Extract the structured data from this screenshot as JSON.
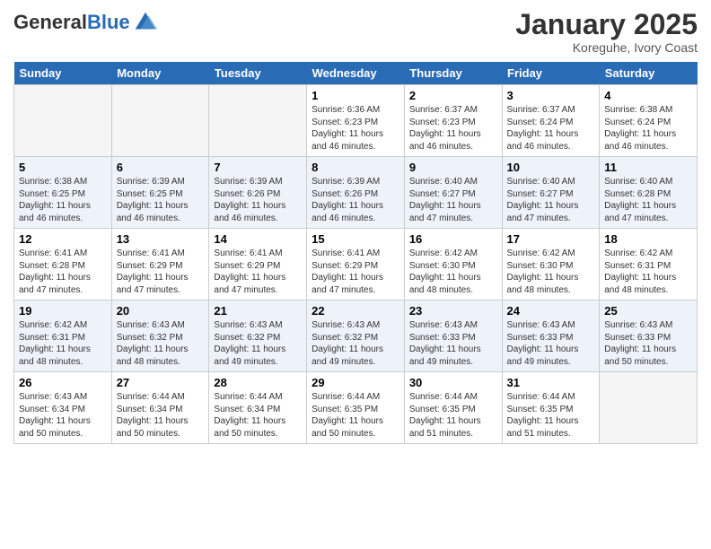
{
  "logo": {
    "general": "General",
    "blue": "Blue"
  },
  "header": {
    "title": "January 2025",
    "location": "Koreguhe, Ivory Coast"
  },
  "days_of_week": [
    "Sunday",
    "Monday",
    "Tuesday",
    "Wednesday",
    "Thursday",
    "Friday",
    "Saturday"
  ],
  "weeks": [
    [
      {
        "day": "",
        "sunrise": "",
        "sunset": "",
        "daylight": ""
      },
      {
        "day": "",
        "sunrise": "",
        "sunset": "",
        "daylight": ""
      },
      {
        "day": "",
        "sunrise": "",
        "sunset": "",
        "daylight": ""
      },
      {
        "day": "1",
        "sunrise": "Sunrise: 6:36 AM",
        "sunset": "Sunset: 6:23 PM",
        "daylight": "Daylight: 11 hours and 46 minutes."
      },
      {
        "day": "2",
        "sunrise": "Sunrise: 6:37 AM",
        "sunset": "Sunset: 6:23 PM",
        "daylight": "Daylight: 11 hours and 46 minutes."
      },
      {
        "day": "3",
        "sunrise": "Sunrise: 6:37 AM",
        "sunset": "Sunset: 6:24 PM",
        "daylight": "Daylight: 11 hours and 46 minutes."
      },
      {
        "day": "4",
        "sunrise": "Sunrise: 6:38 AM",
        "sunset": "Sunset: 6:24 PM",
        "daylight": "Daylight: 11 hours and 46 minutes."
      }
    ],
    [
      {
        "day": "5",
        "sunrise": "Sunrise: 6:38 AM",
        "sunset": "Sunset: 6:25 PM",
        "daylight": "Daylight: 11 hours and 46 minutes."
      },
      {
        "day": "6",
        "sunrise": "Sunrise: 6:39 AM",
        "sunset": "Sunset: 6:25 PM",
        "daylight": "Daylight: 11 hours and 46 minutes."
      },
      {
        "day": "7",
        "sunrise": "Sunrise: 6:39 AM",
        "sunset": "Sunset: 6:26 PM",
        "daylight": "Daylight: 11 hours and 46 minutes."
      },
      {
        "day": "8",
        "sunrise": "Sunrise: 6:39 AM",
        "sunset": "Sunset: 6:26 PM",
        "daylight": "Daylight: 11 hours and 46 minutes."
      },
      {
        "day": "9",
        "sunrise": "Sunrise: 6:40 AM",
        "sunset": "Sunset: 6:27 PM",
        "daylight": "Daylight: 11 hours and 47 minutes."
      },
      {
        "day": "10",
        "sunrise": "Sunrise: 6:40 AM",
        "sunset": "Sunset: 6:27 PM",
        "daylight": "Daylight: 11 hours and 47 minutes."
      },
      {
        "day": "11",
        "sunrise": "Sunrise: 6:40 AM",
        "sunset": "Sunset: 6:28 PM",
        "daylight": "Daylight: 11 hours and 47 minutes."
      }
    ],
    [
      {
        "day": "12",
        "sunrise": "Sunrise: 6:41 AM",
        "sunset": "Sunset: 6:28 PM",
        "daylight": "Daylight: 11 hours and 47 minutes."
      },
      {
        "day": "13",
        "sunrise": "Sunrise: 6:41 AM",
        "sunset": "Sunset: 6:29 PM",
        "daylight": "Daylight: 11 hours and 47 minutes."
      },
      {
        "day": "14",
        "sunrise": "Sunrise: 6:41 AM",
        "sunset": "Sunset: 6:29 PM",
        "daylight": "Daylight: 11 hours and 47 minutes."
      },
      {
        "day": "15",
        "sunrise": "Sunrise: 6:41 AM",
        "sunset": "Sunset: 6:29 PM",
        "daylight": "Daylight: 11 hours and 47 minutes."
      },
      {
        "day": "16",
        "sunrise": "Sunrise: 6:42 AM",
        "sunset": "Sunset: 6:30 PM",
        "daylight": "Daylight: 11 hours and 48 minutes."
      },
      {
        "day": "17",
        "sunrise": "Sunrise: 6:42 AM",
        "sunset": "Sunset: 6:30 PM",
        "daylight": "Daylight: 11 hours and 48 minutes."
      },
      {
        "day": "18",
        "sunrise": "Sunrise: 6:42 AM",
        "sunset": "Sunset: 6:31 PM",
        "daylight": "Daylight: 11 hours and 48 minutes."
      }
    ],
    [
      {
        "day": "19",
        "sunrise": "Sunrise: 6:42 AM",
        "sunset": "Sunset: 6:31 PM",
        "daylight": "Daylight: 11 hours and 48 minutes."
      },
      {
        "day": "20",
        "sunrise": "Sunrise: 6:43 AM",
        "sunset": "Sunset: 6:32 PM",
        "daylight": "Daylight: 11 hours and 48 minutes."
      },
      {
        "day": "21",
        "sunrise": "Sunrise: 6:43 AM",
        "sunset": "Sunset: 6:32 PM",
        "daylight": "Daylight: 11 hours and 49 minutes."
      },
      {
        "day": "22",
        "sunrise": "Sunrise: 6:43 AM",
        "sunset": "Sunset: 6:32 PM",
        "daylight": "Daylight: 11 hours and 49 minutes."
      },
      {
        "day": "23",
        "sunrise": "Sunrise: 6:43 AM",
        "sunset": "Sunset: 6:33 PM",
        "daylight": "Daylight: 11 hours and 49 minutes."
      },
      {
        "day": "24",
        "sunrise": "Sunrise: 6:43 AM",
        "sunset": "Sunset: 6:33 PM",
        "daylight": "Daylight: 11 hours and 49 minutes."
      },
      {
        "day": "25",
        "sunrise": "Sunrise: 6:43 AM",
        "sunset": "Sunset: 6:33 PM",
        "daylight": "Daylight: 11 hours and 50 minutes."
      }
    ],
    [
      {
        "day": "26",
        "sunrise": "Sunrise: 6:43 AM",
        "sunset": "Sunset: 6:34 PM",
        "daylight": "Daylight: 11 hours and 50 minutes."
      },
      {
        "day": "27",
        "sunrise": "Sunrise: 6:44 AM",
        "sunset": "Sunset: 6:34 PM",
        "daylight": "Daylight: 11 hours and 50 minutes."
      },
      {
        "day": "28",
        "sunrise": "Sunrise: 6:44 AM",
        "sunset": "Sunset: 6:34 PM",
        "daylight": "Daylight: 11 hours and 50 minutes."
      },
      {
        "day": "29",
        "sunrise": "Sunrise: 6:44 AM",
        "sunset": "Sunset: 6:35 PM",
        "daylight": "Daylight: 11 hours and 50 minutes."
      },
      {
        "day": "30",
        "sunrise": "Sunrise: 6:44 AM",
        "sunset": "Sunset: 6:35 PM",
        "daylight": "Daylight: 11 hours and 51 minutes."
      },
      {
        "day": "31",
        "sunrise": "Sunrise: 6:44 AM",
        "sunset": "Sunset: 6:35 PM",
        "daylight": "Daylight: 11 hours and 51 minutes."
      },
      {
        "day": "",
        "sunrise": "",
        "sunset": "",
        "daylight": ""
      }
    ]
  ]
}
